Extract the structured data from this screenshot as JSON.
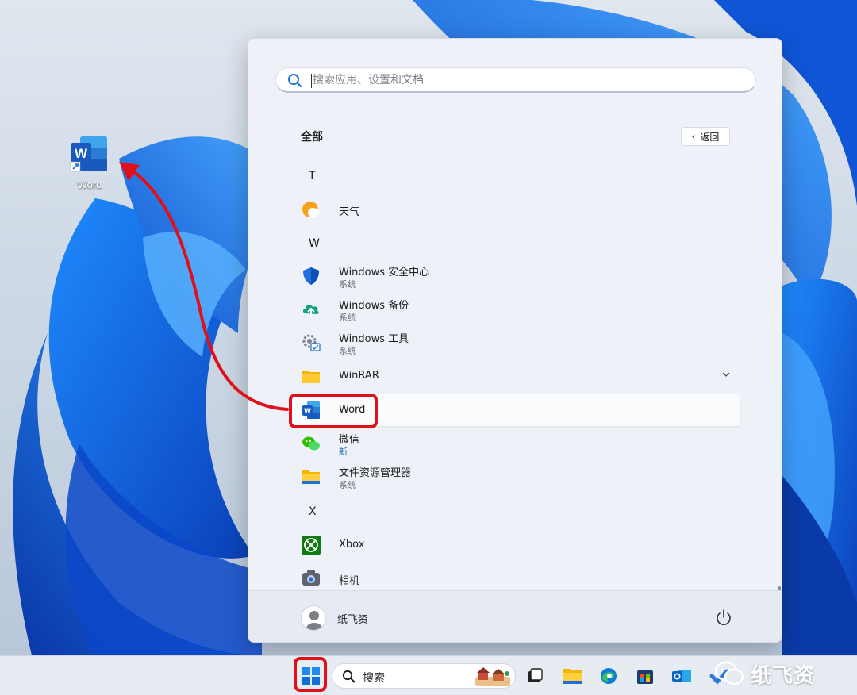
{
  "desktop": {
    "icon_label": "Word"
  },
  "start_menu": {
    "search_placeholder": "搜索应用、设置和文档",
    "section_title": "全部",
    "back_label": "返回",
    "letters": [
      "T",
      "W",
      "X"
    ],
    "apps": [
      {
        "name": "天气",
        "sub": "",
        "icon": "weather-icon"
      },
      {
        "name": "Windows 安全中心",
        "sub": "系统",
        "icon": "shield-icon"
      },
      {
        "name": "Windows 备份",
        "sub": "系统",
        "icon": "backup-icon"
      },
      {
        "name": "Windows 工具",
        "sub": "系统",
        "icon": "tools-icon"
      },
      {
        "name": "WinRAR",
        "sub": "",
        "icon": "folder-icon"
      },
      {
        "name": "Word",
        "sub": "",
        "icon": "word-icon"
      },
      {
        "name": "微信",
        "sub": "新",
        "icon": "wechat-icon"
      },
      {
        "name": "文件资源管理器",
        "sub": "系统",
        "icon": "file-explorer-icon"
      },
      {
        "name": "Xbox",
        "sub": "",
        "icon": "xbox-icon"
      },
      {
        "name": "相机",
        "sub": "",
        "icon": "camera-icon"
      }
    ],
    "user_name": "纸飞资"
  },
  "taskbar": {
    "search_placeholder": "搜索",
    "icons": [
      "start-icon",
      "search-icon",
      "task-view-icon",
      "file-explorer-icon",
      "edge-icon",
      "store-icon",
      "outlook-icon",
      "todo-icon"
    ]
  },
  "watermark": {
    "text": "纸飞资"
  },
  "colors": {
    "accent_blue": "#1d6fe0",
    "highlight_red": "#e0101a",
    "menu_bg": "#eef1f8",
    "taskbar_bg": "#e7ebf2"
  }
}
